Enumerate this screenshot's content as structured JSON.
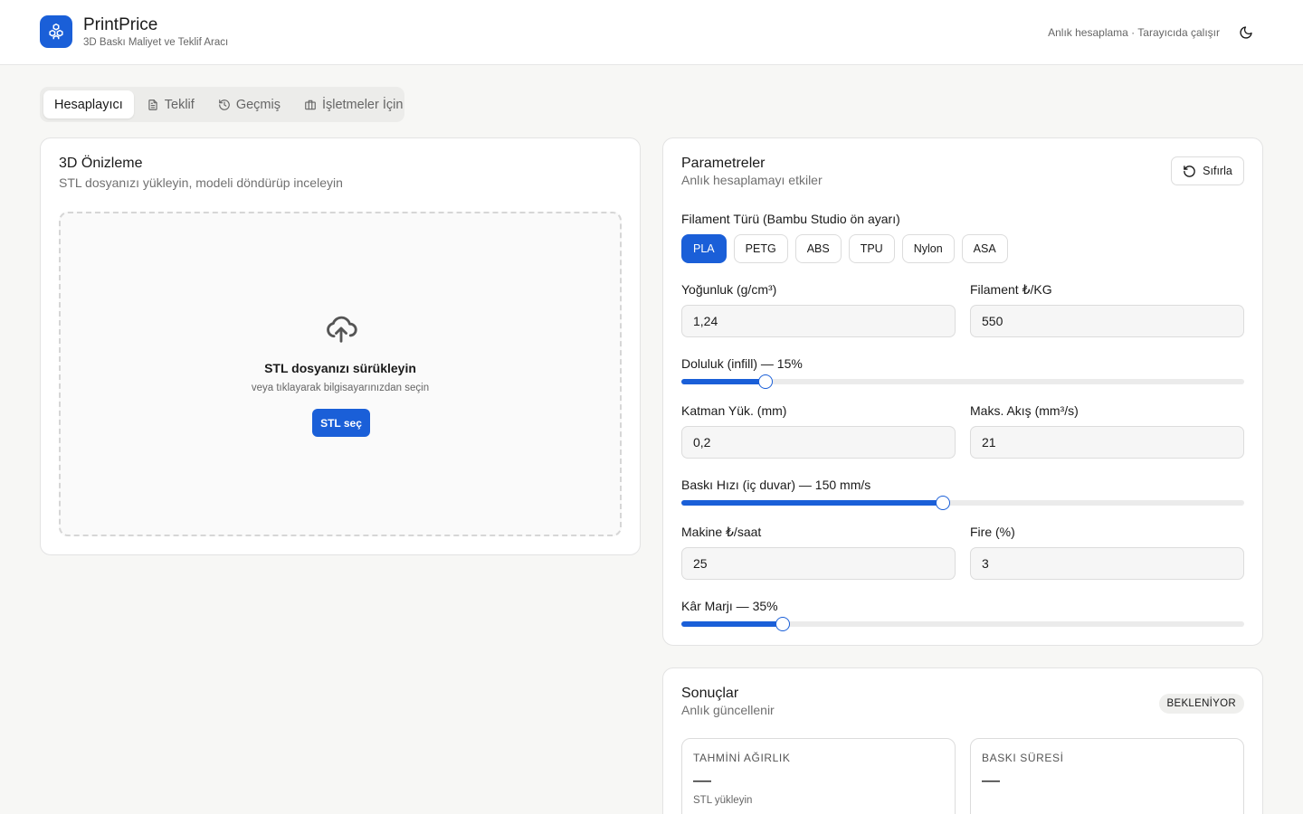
{
  "header": {
    "app_title": "PrintPrice",
    "app_subtitle": "3D Baskı Maliyet ve Teklif Aracı",
    "status": "Anlık hesaplama · Tarayıcıda çalışır",
    "theme_icon": "moon-icon",
    "logo_icon": "cubes-icon"
  },
  "tabs": [
    {
      "label": "Hesaplayıcı",
      "icon": "",
      "active": true
    },
    {
      "label": "Teklif",
      "icon": "document-icon",
      "active": false
    },
    {
      "label": "Geçmiş",
      "icon": "history-icon",
      "active": false
    },
    {
      "label": "İşletmeler İçin",
      "icon": "briefcase-icon",
      "active": false
    }
  ],
  "preview": {
    "title": "3D Önizleme",
    "subtitle": "STL dosyanızı yükleyin, modeli döndürüp inceleyin",
    "drop_title": "STL dosyanızı sürükleyin",
    "drop_hint": "veya tıklayarak bilgisayarınızdan seçin",
    "button_label": "STL seç",
    "upload_icon": "cloud-upload-icon"
  },
  "params": {
    "title": "Parametreler",
    "subtitle": "Anlık hesaplamayı etkiler",
    "reset_label": "Sıfırla",
    "filament_label": "Filament Türü (Bambu Studio ön ayarı)",
    "filaments": [
      "PLA",
      "PETG",
      "ABS",
      "TPU",
      "Nylon",
      "ASA"
    ],
    "selected_filament": "PLA",
    "density_label": "Yoğunluk (g/cm³)",
    "density_value": "1,24",
    "price_label": "Filament ₺/KG",
    "price_value": "550",
    "infill_label": "Doluluk (infill) — 15%",
    "infill_percent": 15,
    "layer_label": "Katman Yük. (mm)",
    "layer_value": "0,2",
    "flow_label": "Maks. Akış (mm³/s)",
    "flow_value": "21",
    "speed_label": "Baskı Hızı (iç duvar) — 150 mm/s",
    "speed_percent": 46.5,
    "machine_label": "Makine ₺/saat",
    "machine_value": "25",
    "waste_label": "Fire (%)",
    "waste_value": "3",
    "margin_label": "Kâr Marjı — 35%",
    "margin_percent": 18
  },
  "results": {
    "title": "Sonuçlar",
    "subtitle": "Anlık güncellenir",
    "status_badge": "BEKLENİYOR",
    "weight_label": "TAHMİNİ AĞIRLIK",
    "weight_value": "—",
    "weight_hint": "STL yükleyin",
    "time_label": "BASKI SÜRESİ",
    "time_value": "—"
  },
  "colors": {
    "accent": "#1a5fd8",
    "background": "#f7f7f5"
  }
}
